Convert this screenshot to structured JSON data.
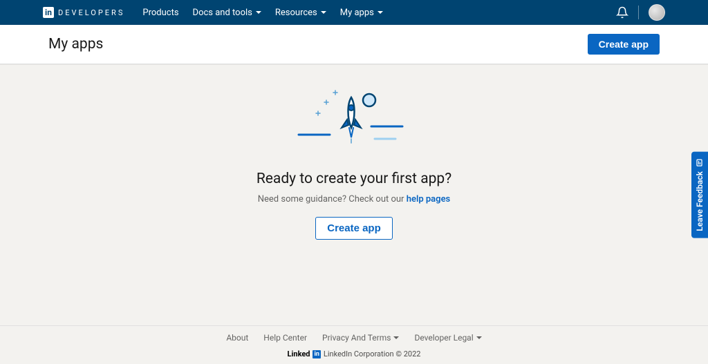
{
  "nav": {
    "brand_text": "DEVELOPERS",
    "items": [
      {
        "label": "Products",
        "has_caret": false
      },
      {
        "label": "Docs and tools",
        "has_caret": true
      },
      {
        "label": "Resources",
        "has_caret": true
      },
      {
        "label": "My apps",
        "has_caret": true
      }
    ]
  },
  "page": {
    "title": "My apps",
    "create_button": "Create app"
  },
  "empty_state": {
    "headline": "Ready to create your first app?",
    "subline_prefix": "Need some guidance? Check out our ",
    "subline_link": "help pages",
    "cta": "Create app"
  },
  "feedback": {
    "label": "Leave Feedback"
  },
  "footer": {
    "links": [
      {
        "label": "About",
        "caret": false
      },
      {
        "label": "Help Center",
        "caret": false
      },
      {
        "label": "Privacy And Terms",
        "caret": true
      },
      {
        "label": "Developer Legal",
        "caret": true
      }
    ],
    "brand_prefix": "Linked",
    "brand_box": "in",
    "copyright": "LinkedIn Corporation © 2022"
  }
}
